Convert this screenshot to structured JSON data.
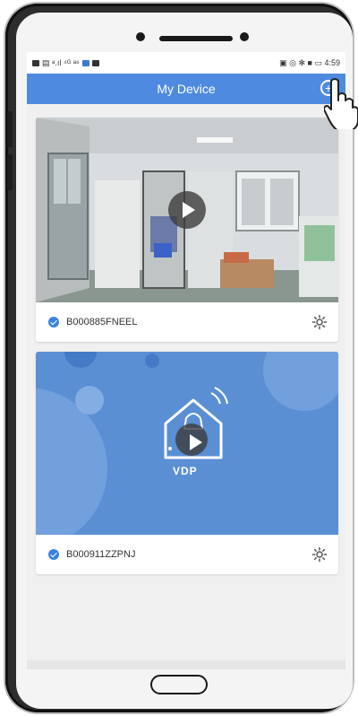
{
  "statusbar": {
    "left_text": "▤ ᵃ.ıl ⁴ᴳ ᵃ⁶",
    "right_text": "▣ ◎ ✻ ■ ▭ 4:59"
  },
  "navbar": {
    "title": "My Device",
    "add_icon": "plus-circle-icon"
  },
  "devices": [
    {
      "id": "B000885FNEEL",
      "icon": "gear-icon"
    },
    {
      "id": "B000911ZZPNJ",
      "icon": "gear-icon"
    }
  ],
  "vdp": {
    "label": "VDP"
  },
  "colors": {
    "accent": "#4e8be0",
    "check": "#3a82e0",
    "vdp_bg": "#5b8fd4"
  }
}
